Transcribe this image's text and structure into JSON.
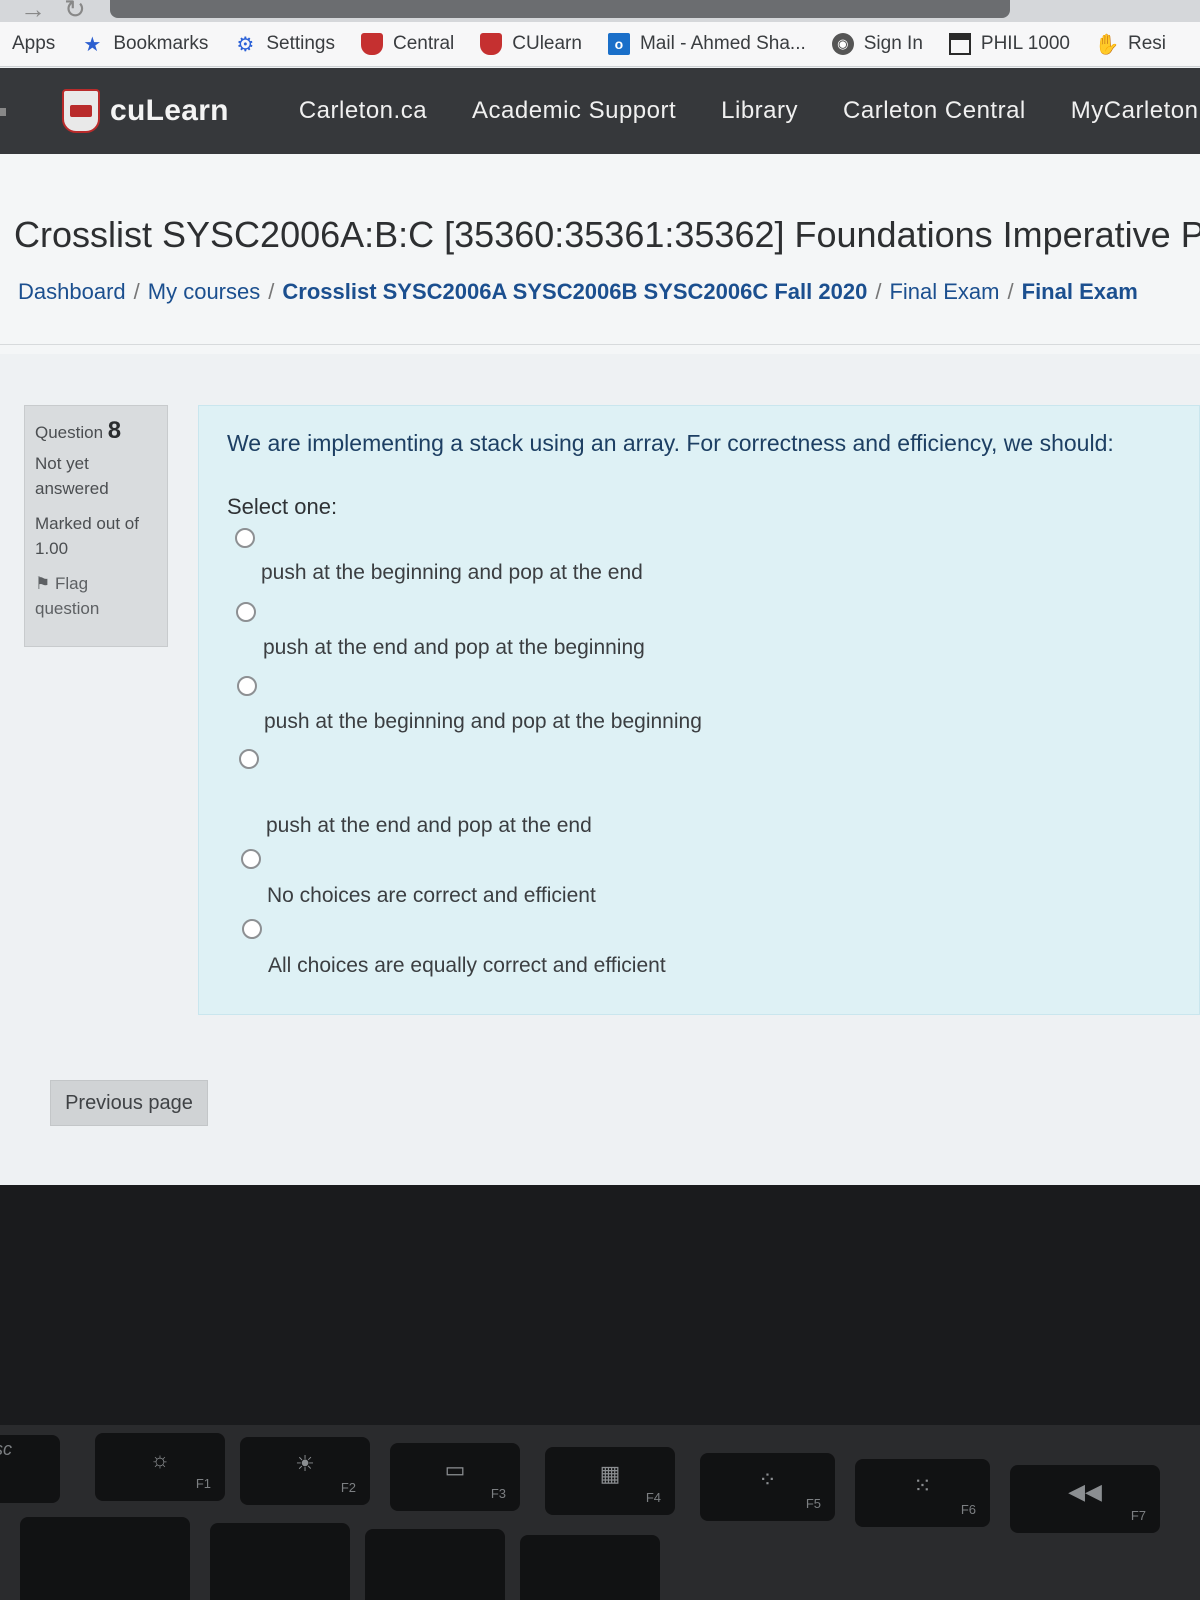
{
  "bookmarks": [
    {
      "label": "Apps",
      "icon": "apps-icon"
    },
    {
      "label": "Bookmarks",
      "icon": "star-icon"
    },
    {
      "label": "Settings",
      "icon": "gear-icon"
    },
    {
      "label": "Central",
      "icon": "shield-icon"
    },
    {
      "label": "CUlearn",
      "icon": "shield-icon"
    },
    {
      "label": "Mail - Ahmed Sha...",
      "icon": "outlook-icon"
    },
    {
      "label": "Sign In",
      "icon": "globe-icon"
    },
    {
      "label": "PHIL 1000",
      "icon": "calendar-icon"
    },
    {
      "label": "Resi",
      "icon": "hand-icon"
    }
  ],
  "navbar": {
    "brand": "cuLearn",
    "links": [
      "Carleton.ca",
      "Academic Support",
      "Library",
      "Carleton Central",
      "MyCarleton"
    ]
  },
  "page": {
    "title": "Crosslist SYSC2006A:B:C [35360:35361:35362] Foundations Imperative P",
    "breadcrumb": [
      {
        "label": "Dashboard",
        "bold": false
      },
      {
        "label": "My courses",
        "bold": false
      },
      {
        "label": "Crosslist SYSC2006A SYSC2006B SYSC2006C Fall 2020",
        "bold": true
      },
      {
        "label": "Final Exam",
        "bold": false
      },
      {
        "label": "Final Exam",
        "bold": true
      }
    ]
  },
  "question_info": {
    "question_label": "Question",
    "question_number": "8",
    "status": "Not yet answered",
    "marked_out_of_label": "Marked out of",
    "marked_out_of_value": "1.00",
    "flag_label": "Flag question"
  },
  "question": {
    "text": "We are implementing a stack using an array.  For correctness and efficiency, we should:",
    "prompt": "Select one:",
    "options": [
      "push at the beginning and pop at the end",
      "push at the end and pop at the beginning",
      "push at the beginning and pop at the beginning",
      "push at the end and pop at the end",
      "No choices are correct and efficient",
      "All choices are equally correct and efficient"
    ]
  },
  "buttons": {
    "previous_page": "Previous page"
  },
  "keyboard": {
    "keys": [
      "esc",
      "F1",
      "F2",
      "F3",
      "F4",
      "F5",
      "F6",
      "F7"
    ]
  }
}
